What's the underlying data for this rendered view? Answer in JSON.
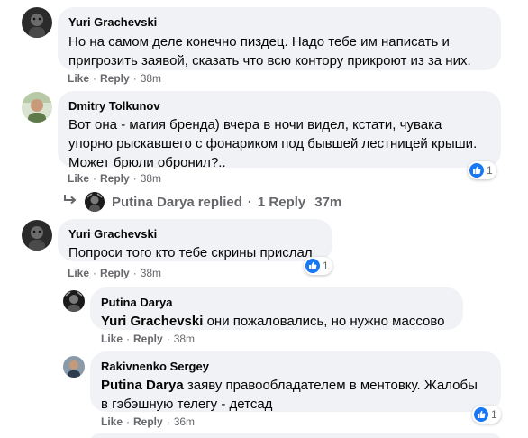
{
  "comments": [
    {
      "author": "Yuri Grachevski",
      "lines": [
        "Но на самом деле конечно пиздец. Надо тебе им написать и",
        "пригрозить заявой, сказать что всю контору прикроют из за них."
      ],
      "like": "Like",
      "reply": "Reply",
      "time": "38m"
    },
    {
      "author": "Dmitry Tolkunov",
      "lines": [
        "Вот она - магия бренда) вчера в ночи видел, кстати, чувака",
        "упорно рыскавшего с фонариком под бывшей лестницей крыши.",
        "Может брюли обронил?.."
      ],
      "like": "Like",
      "reply": "Reply",
      "time": "38m",
      "reactions": "1",
      "replied": {
        "author": "Putina Darya",
        "verb": "replied",
        "count": "1 Reply",
        "time": "37m"
      }
    },
    {
      "author": "Yuri Grachevski",
      "lines": [
        "Попроси того кто тебе скрины прислал"
      ],
      "like": "Like",
      "reply": "Reply",
      "time": "38m",
      "reactions": "1"
    }
  ],
  "replies": [
    {
      "author": "Putina Darya",
      "mention": "Yuri Grachevski",
      "text": " они пожаловались, но нужно массово",
      "like": "Like",
      "reply": "Reply",
      "time": "38m"
    },
    {
      "author": "Rakivnenko Sergey",
      "mention": "Putina Darya",
      "text_line1": " заяву правообладателем в ментовку. Жалобы",
      "text_line2": "в гэбэшную телегу - детсад",
      "like": "Like",
      "reply": "Reply",
      "time": "36m",
      "reactions": "1"
    }
  ],
  "separator": "·",
  "icons": {
    "like": "thumbs-up-icon",
    "reply-arrow": "reply-arrow-icon"
  },
  "colors": {
    "bubble": "#f0f2f5",
    "like_blue": "#1877f2",
    "meta_gray": "#65676b"
  }
}
